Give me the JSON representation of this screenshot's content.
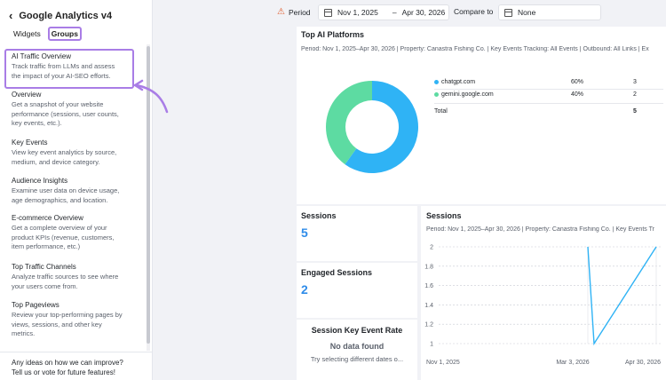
{
  "sidebar": {
    "title": "Google Analytics v4",
    "tabs": [
      {
        "label": "Widgets",
        "active": false
      },
      {
        "label": "Groups",
        "active": true
      }
    ],
    "groups": [
      {
        "title": "AI Traffic Overview",
        "desc": [
          "Track traffic from LLMs and assess",
          "the impact of your AI-SEO efforts."
        ]
      },
      {
        "title": "Overview",
        "desc": [
          "Get a snapshot of your website",
          "performance (sessions, user counts,",
          "key events, etc.)."
        ]
      },
      {
        "title": "Key Events",
        "desc": [
          "View key event analytics by source,",
          "medium, and device category."
        ]
      },
      {
        "title": "Audience Insights",
        "desc": [
          "Examine user data on device usage,",
          "age demographics, and location."
        ]
      },
      {
        "title": "E-commerce Overview",
        "desc": [
          "Get a complete overview of your",
          "product KPIs (revenue, customers,",
          "item performance, etc.)"
        ]
      },
      {
        "title": "Top Traffic Channels",
        "desc": [
          "Analyze traffic sources to see where",
          "your users come from."
        ]
      },
      {
        "title": "Top Pageviews",
        "desc": [
          "Review your top-performing pages by",
          "views, sessions, and other key",
          "metrics."
        ]
      }
    ],
    "footer": [
      "Any ideas on how we can improve?",
      "Tell us or vote for future features!"
    ]
  },
  "topbar": {
    "period_label": "Period",
    "date_start": "Nov 1, 2025",
    "date_sep": "–",
    "date_end": "Apr 30, 2026",
    "compare_label": "Compare to",
    "compare_value": "None"
  },
  "platforms_card": {
    "title": "Top AI Platforms",
    "subtitle": "Period: Nov 1, 2025–Apr 30, 2026 | Property: Canastra Fishing Co. | Key Events Tracking: All Events | Outbound: All Links | Ex",
    "rows": [
      {
        "name": "chatgpt.com",
        "pct": "60%",
        "count": "3",
        "color": "#2fb3f5"
      },
      {
        "name": "gemini.google.com",
        "pct": "40%",
        "count": "2",
        "color": "#5ddba2"
      }
    ],
    "total_label": "Total",
    "total_value": "5"
  },
  "metrics": {
    "sessions_title": "Sessions",
    "sessions_value": "5",
    "engaged_title": "Engaged Sessions",
    "engaged_value": "2",
    "rate_title": "Session Key Event Rate",
    "rate_nodata": "No data found",
    "rate_hint": "Try selecting different dates o..."
  },
  "chart_data": {
    "type": "line",
    "title": "Sessions",
    "subtitle": "Period: Nov 1, 2025–Apr 30, 2026 | Property: Canastra Fishing Co. | Key Events Tr",
    "x_ticks": [
      "Nov 1, 2025",
      "Mar 3, 2026",
      "Apr 30, 2026"
    ],
    "y_ticks": [
      "2",
      "1.8",
      "1.6",
      "1.4",
      "1.2",
      "1"
    ],
    "ylim": [
      1,
      2
    ],
    "series": [
      {
        "values": [
          {
            "x": "Mar 1, 2026",
            "y": 2
          },
          {
            "x": "Mar 6, 2026",
            "y": 1
          },
          {
            "x": "Apr 25, 2026",
            "y": 2
          }
        ],
        "color": "#2fb3f5"
      }
    ],
    "grid": true
  },
  "donut": {
    "values": [
      3,
      2
    ],
    "colors": [
      "#2fb3f5",
      "#5ddba2"
    ]
  }
}
